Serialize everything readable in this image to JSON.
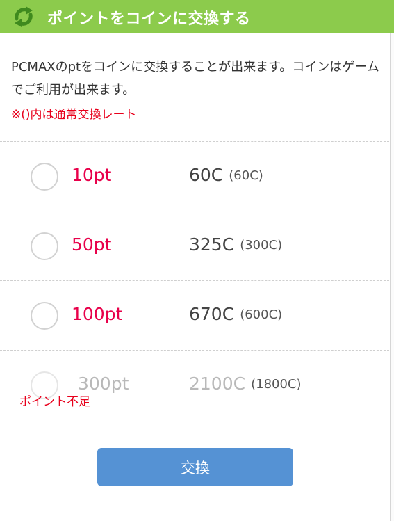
{
  "header": {
    "title": "ポイントをコインに交換する",
    "icon": "exchange-arrows-icon",
    "color": "#8ccb4c"
  },
  "description": "PCMAXのptをコインに交換することが出来ます。コインはゲームでご利用が出来ます。",
  "note": "※()内は通常交換レート",
  "options": [
    {
      "points": "10pt",
      "coins": "60C",
      "normal_rate": "(60C)",
      "disabled": false
    },
    {
      "points": "50pt",
      "coins": "325C",
      "normal_rate": "(300C)",
      "disabled": false
    },
    {
      "points": "100pt",
      "coins": "670C",
      "normal_rate": "(600C)",
      "disabled": false
    },
    {
      "points": "300pt",
      "coins": "2100C",
      "normal_rate": "(1800C)",
      "disabled": true,
      "warning": "ポイント不足"
    }
  ],
  "button": {
    "label": "交換",
    "color": "#5592d4"
  },
  "colors": {
    "points": "#e8004a",
    "warning": "#e8001c"
  }
}
